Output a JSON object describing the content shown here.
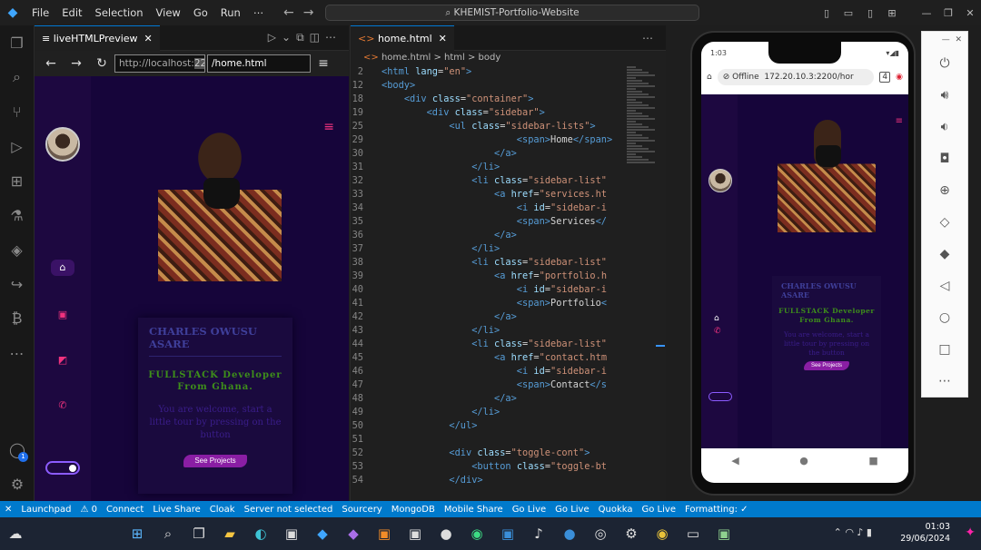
{
  "menu": [
    "File",
    "Edit",
    "Selection",
    "View",
    "Go",
    "Run",
    "⋯"
  ],
  "command_center": "⌕ KHEMIST-Portfolio-Website",
  "preview": {
    "tab": "liveHTMLPreview",
    "url_host": "http://localhost:",
    "url_port": "2200",
    "url_path": "/home.html",
    "site": {
      "name": "CHARLES OWUSU ASARE",
      "role": "FULLSTACK Developer From Ghana.",
      "welcome": "You are welcome, start a little tour by pressing on the button",
      "button": "See Projects"
    }
  },
  "editor": {
    "tab": "home.html",
    "breadcrumb": [
      "home.html",
      "html",
      "body"
    ],
    "lines": [
      {
        "n": "2",
        "c": [
          [
            "tg",
            "<html "
          ],
          [
            "at",
            "lang"
          ],
          [
            "tx",
            "="
          ],
          [
            "st",
            "\"en\""
          ],
          [
            "tg",
            ">"
          ]
        ]
      },
      {
        "n": "12",
        "c": [
          [
            "tg",
            "<body>"
          ]
        ]
      },
      {
        "n": "18",
        "c": [
          [
            "tx",
            "    "
          ],
          [
            "tg",
            "<div "
          ],
          [
            "at",
            "class"
          ],
          [
            "tx",
            "="
          ],
          [
            "st",
            "\"container\""
          ],
          [
            "tg",
            ">"
          ]
        ]
      },
      {
        "n": "19",
        "c": [
          [
            "tx",
            "        "
          ],
          [
            "tg",
            "<div "
          ],
          [
            "at",
            "class"
          ],
          [
            "tx",
            "="
          ],
          [
            "st",
            "\"sidebar\""
          ],
          [
            "tg",
            ">"
          ]
        ]
      },
      {
        "n": "25",
        "c": [
          [
            "tx",
            "            "
          ],
          [
            "tg",
            "<ul "
          ],
          [
            "at",
            "class"
          ],
          [
            "tx",
            "="
          ],
          [
            "st",
            "\"sidebar-lists\""
          ],
          [
            "tg",
            ">"
          ]
        ]
      },
      {
        "n": "29",
        "c": [
          [
            "tx",
            "                        "
          ],
          [
            "tg",
            "<span>"
          ],
          [
            "tx",
            "Home"
          ],
          [
            "tg",
            "</span>"
          ]
        ]
      },
      {
        "n": "30",
        "c": [
          [
            "tx",
            "                    "
          ],
          [
            "tg",
            "</a>"
          ]
        ]
      },
      {
        "n": "31",
        "c": [
          [
            "tx",
            "                "
          ],
          [
            "tg",
            "</li>"
          ]
        ]
      },
      {
        "n": "32",
        "c": [
          [
            "tx",
            "                "
          ],
          [
            "tg",
            "<li "
          ],
          [
            "at",
            "class"
          ],
          [
            "tx",
            "="
          ],
          [
            "st",
            "\"sidebar-list\""
          ]
        ]
      },
      {
        "n": "33",
        "c": [
          [
            "tx",
            "                    "
          ],
          [
            "tg",
            "<a "
          ],
          [
            "at",
            "href"
          ],
          [
            "tx",
            "="
          ],
          [
            "st",
            "\"services.ht"
          ]
        ]
      },
      {
        "n": "34",
        "c": [
          [
            "tx",
            "                        "
          ],
          [
            "tg",
            "<i "
          ],
          [
            "at",
            "id"
          ],
          [
            "tx",
            "="
          ],
          [
            "st",
            "\"sidebar-i"
          ]
        ]
      },
      {
        "n": "35",
        "c": [
          [
            "tx",
            "                        "
          ],
          [
            "tg",
            "<span>"
          ],
          [
            "tx",
            "Services"
          ],
          [
            "tg",
            "</"
          ]
        ]
      },
      {
        "n": "36",
        "c": [
          [
            "tx",
            "                    "
          ],
          [
            "tg",
            "</a>"
          ]
        ]
      },
      {
        "n": "37",
        "c": [
          [
            "tx",
            "                "
          ],
          [
            "tg",
            "</li>"
          ]
        ]
      },
      {
        "n": "38",
        "c": [
          [
            "tx",
            "                "
          ],
          [
            "tg",
            "<li "
          ],
          [
            "at",
            "class"
          ],
          [
            "tx",
            "="
          ],
          [
            "st",
            "\"sidebar-list\""
          ]
        ]
      },
      {
        "n": "39",
        "c": [
          [
            "tx",
            "                    "
          ],
          [
            "tg",
            "<a "
          ],
          [
            "at",
            "href"
          ],
          [
            "tx",
            "="
          ],
          [
            "st",
            "\"portfolio.h"
          ]
        ]
      },
      {
        "n": "40",
        "c": [
          [
            "tx",
            "                        "
          ],
          [
            "tg",
            "<i "
          ],
          [
            "at",
            "id"
          ],
          [
            "tx",
            "="
          ],
          [
            "st",
            "\"sidebar-i"
          ]
        ]
      },
      {
        "n": "41",
        "c": [
          [
            "tx",
            "                        "
          ],
          [
            "tg",
            "<span>"
          ],
          [
            "tx",
            "Portfolio"
          ],
          [
            "tg",
            "<"
          ]
        ]
      },
      {
        "n": "42",
        "c": [
          [
            "tx",
            "                    "
          ],
          [
            "tg",
            "</a>"
          ]
        ]
      },
      {
        "n": "43",
        "c": [
          [
            "tx",
            "                "
          ],
          [
            "tg",
            "</li>"
          ]
        ]
      },
      {
        "n": "44",
        "c": [
          [
            "tx",
            "                "
          ],
          [
            "tg",
            "<li "
          ],
          [
            "at",
            "class"
          ],
          [
            "tx",
            "="
          ],
          [
            "st",
            "\"sidebar-list\""
          ]
        ]
      },
      {
        "n": "45",
        "c": [
          [
            "tx",
            "                    "
          ],
          [
            "tg",
            "<a "
          ],
          [
            "at",
            "href"
          ],
          [
            "tx",
            "="
          ],
          [
            "st",
            "\"contact.htm"
          ]
        ]
      },
      {
        "n": "46",
        "c": [
          [
            "tx",
            "                        "
          ],
          [
            "tg",
            "<i "
          ],
          [
            "at",
            "id"
          ],
          [
            "tx",
            "="
          ],
          [
            "st",
            "\"sidebar-i"
          ]
        ]
      },
      {
        "n": "47",
        "c": [
          [
            "tx",
            "                        "
          ],
          [
            "tg",
            "<span>"
          ],
          [
            "tx",
            "Contact"
          ],
          [
            "tg",
            "</s"
          ]
        ]
      },
      {
        "n": "48",
        "c": [
          [
            "tx",
            "                    "
          ],
          [
            "tg",
            "</a>"
          ]
        ]
      },
      {
        "n": "49",
        "c": [
          [
            "tx",
            "                "
          ],
          [
            "tg",
            "</li>"
          ]
        ]
      },
      {
        "n": "50",
        "c": [
          [
            "tx",
            "            "
          ],
          [
            "tg",
            "</ul>"
          ]
        ]
      },
      {
        "n": "51",
        "c": []
      },
      {
        "n": "52",
        "c": [
          [
            "tx",
            "            "
          ],
          [
            "tg",
            "<div "
          ],
          [
            "at",
            "class"
          ],
          [
            "tx",
            "="
          ],
          [
            "st",
            "\"toggle-cont\""
          ],
          [
            "tg",
            ">"
          ]
        ]
      },
      {
        "n": "53",
        "c": [
          [
            "tx",
            "                "
          ],
          [
            "tg",
            "<button "
          ],
          [
            "at",
            "class"
          ],
          [
            "tx",
            "="
          ],
          [
            "st",
            "\"toggle-bt"
          ]
        ]
      },
      {
        "n": "54",
        "c": [
          [
            "tx",
            "            "
          ],
          [
            "tg",
            "</div>"
          ]
        ]
      }
    ]
  },
  "phone": {
    "time": "1:03",
    "offline": "Offline",
    "url": "172.20.10.3:2200/hor",
    "tab_count": "4"
  },
  "statusbar": [
    "✕",
    "Launchpad",
    "⚠ 0",
    "Connect",
    "Live Share",
    "Cloak",
    "Server not selected",
    "Sourcery",
    "MongoDB",
    "Mobile Share",
    "Go Live",
    "Go Live",
    "Quokka",
    "Go Live",
    "Formatting: ✓"
  ],
  "clock": {
    "time": "01:03",
    "date": "29/06/2024"
  }
}
